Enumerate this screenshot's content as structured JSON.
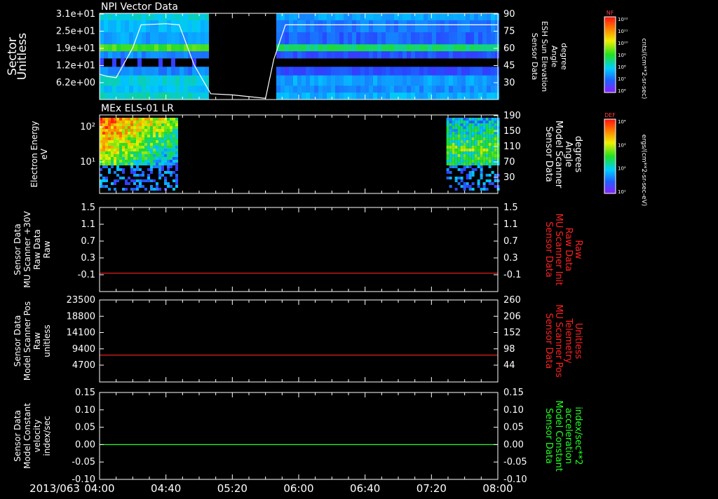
{
  "date_label": "2013/063",
  "time_ticks": [
    "04:00",
    "04:40",
    "05:20",
    "06:00",
    "06:40",
    "07:20",
    "08:00"
  ],
  "chart_data": [
    {
      "type": "heatmap",
      "title": "NPI Vector Data",
      "ylabel_left": [
        "Sector",
        "Unitless"
      ],
      "yticks_left": [
        "3.1e+01",
        "2.5e+01",
        "1.9e+01",
        "1.2e+01",
        "6.2e+00"
      ],
      "ylabel_right": [
        "Sensor Data",
        "ESH Sun Elevation",
        "Angle",
        "degree"
      ],
      "yticks_right": [
        "90",
        "75",
        "60",
        "45",
        "30"
      ],
      "ylim_right": [
        15,
        90
      ],
      "data_gap": [
        "05:07",
        "05:44"
      ],
      "overlay_line": {
        "color": "#ffffff",
        "axis": "right",
        "points": [
          [
            "04:00",
            37
          ],
          [
            "04:05",
            35
          ],
          [
            "04:10",
            34
          ],
          [
            "04:20",
            60
          ],
          [
            "04:25",
            80
          ],
          [
            "04:40",
            81
          ],
          [
            "04:48",
            80
          ],
          [
            "04:57",
            45
          ],
          [
            "05:07",
            20
          ],
          [
            "05:20",
            19
          ],
          [
            "05:40",
            16
          ],
          [
            "05:45",
            50
          ],
          [
            "05:52",
            80
          ],
          [
            "08:00",
            80
          ]
        ]
      },
      "colorbar": {
        "label": "NF",
        "units": "cnts/(cm**2-sr-sec)",
        "ticks": [
          "10¹²",
          "10¹¹",
          "10¹⁰",
          "10⁹",
          "10⁸",
          "10⁷",
          "10⁶"
        ]
      }
    },
    {
      "type": "heatmap",
      "title": "MEx ELS-01 LR",
      "ylabel_left": [
        "Electron Energy",
        "eV"
      ],
      "yticks_left": [
        "10²",
        "10¹"
      ],
      "ylabel_right": [
        "Sensor Data",
        "Model Scanner",
        "Angle",
        "degrees"
      ],
      "yticks_right": [
        "190",
        "150",
        "110",
        "70",
        "30"
      ],
      "data_intervals": [
        [
          "04:00",
          "04:47"
        ],
        [
          "07:29",
          "08:00"
        ]
      ],
      "colorbar": {
        "label": "DEF",
        "units": "ergs/(cm**2-sr-sec-eV)",
        "ticks": [
          "10⁴",
          "10³",
          "10²",
          "10¹"
        ]
      }
    },
    {
      "type": "line",
      "ylabel_left": [
        "Sensor Data",
        "MU Scanner +30V",
        "Raw Data",
        "Raw"
      ],
      "yticks_left": [
        "1.5",
        "1.1",
        "0.7",
        "0.3",
        "-0.1"
      ],
      "ylim": [
        -0.42,
        1.5
      ],
      "ylabel_right": [
        "Sensor Data",
        "MU Scanner Init",
        "Raw Data",
        "Raw"
      ],
      "right_label_color": "#ff2020",
      "yticks_right": [
        "1.5",
        "1.1",
        "0.7",
        "0.3",
        "-0.1"
      ],
      "series": [
        {
          "color": "#ff2020",
          "x": [
            "04:00",
            "08:00"
          ],
          "y": [
            0.0,
            0.0
          ]
        }
      ]
    },
    {
      "type": "line",
      "ylabel_left": [
        "Sensor Data",
        "Model Scanner Pos",
        "Raw",
        "unitless"
      ],
      "yticks_left": [
        "23500",
        "18800",
        "14100",
        "9400",
        "4700"
      ],
      "ylim": [
        0,
        23500
      ],
      "ylabel_right": [
        "Sensor Data",
        "MU Scanner Pos",
        "Telemetry",
        "Unitless"
      ],
      "right_label_color": "#ff2020",
      "yticks_right": [
        "260",
        "206",
        "152",
        "98",
        "44"
      ],
      "series": [
        {
          "color": "#ff2020",
          "x": [
            "04:00",
            "08:00"
          ],
          "y": [
            7700,
            7700
          ]
        }
      ]
    },
    {
      "type": "line",
      "ylabel_left": [
        "Sensor Data",
        "Model Constant",
        "velocity",
        "index/sec"
      ],
      "yticks_left": [
        "0.15",
        "0.10",
        "0.05",
        "0.00",
        "-0.05",
        "-0.10"
      ],
      "ylim": [
        -0.1,
        0.15
      ],
      "ylabel_right": [
        "Sensor Data",
        "Model Constant",
        "acceleration",
        "index/sec**2"
      ],
      "right_label_color": "#20ff20",
      "yticks_right": [
        "0.15",
        "0.10",
        "0.05",
        "0.00",
        "-0.05",
        "-0.10"
      ],
      "series": [
        {
          "color": "#20ff20",
          "x": [
            "04:00",
            "08:00"
          ],
          "y": [
            0.0,
            0.0
          ]
        }
      ]
    }
  ]
}
